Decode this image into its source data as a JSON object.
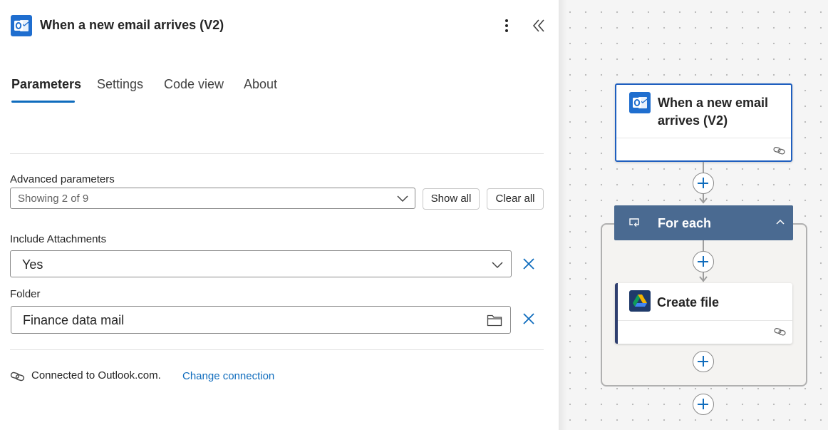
{
  "panel": {
    "title": "When a new email arrives (V2)",
    "tabs": [
      {
        "label": "Parameters",
        "active": true
      },
      {
        "label": "Settings",
        "active": false
      },
      {
        "label": "Code view",
        "active": false
      },
      {
        "label": "About",
        "active": false
      }
    ],
    "advanced": {
      "label": "Advanced parameters",
      "selected": "Showing 2 of 9",
      "show_all": "Show all",
      "clear_all": "Clear all"
    },
    "include_attachments": {
      "label": "Include Attachments",
      "value": "Yes"
    },
    "folder": {
      "label": "Folder",
      "value": "Finance data mail"
    },
    "connection": {
      "text": "Connected to Outlook.com.",
      "link": "Change connection"
    }
  },
  "canvas": {
    "trigger": {
      "title": "When a new email arrives (V2)",
      "icon": "outlook-icon"
    },
    "foreach": {
      "title": "For each",
      "icon": "loop-icon"
    },
    "action": {
      "title": "Create file",
      "icon": "google-drive-icon"
    }
  },
  "colors": {
    "accent": "#0f6cbd",
    "outlook": "#1f6ecf",
    "foreach_header": "#4a6a91",
    "trigger_border": "#1f5fbf"
  }
}
